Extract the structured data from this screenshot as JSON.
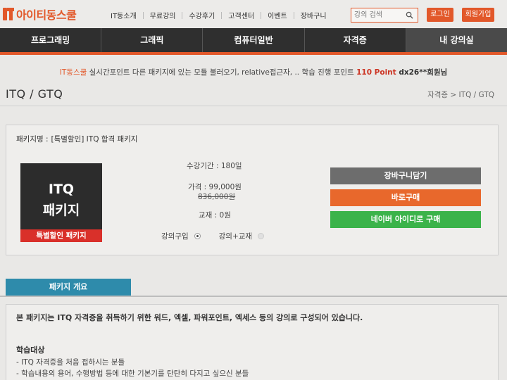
{
  "header": {
    "logo_text": "아이티동스쿨",
    "nav": [
      "IT동소개",
      "무료강의",
      "수강후기",
      "고객센터",
      "이벤트",
      "장바구니"
    ],
    "search_placeholder": "강의 검색",
    "login": "로그인",
    "join": "회원가입"
  },
  "main_nav": [
    "프로그래밍",
    "그래픽",
    "컴퓨터일반",
    "자격증",
    "내 강의실"
  ],
  "notice": {
    "brand": "IT동스쿨",
    "message": " 실시간포인트 다른 패키지에 있는 모듈 불러오기, relative접근자, .. 학습 진행 포인트 ",
    "points": "110 Point",
    "user": " dx26**회원님"
  },
  "page": {
    "title": "ITQ / GTQ",
    "breadcrumb": "자격증 > ITQ / GTQ"
  },
  "package": {
    "name_label": "패키지명 :",
    "name": "[특별할인] ITQ 합격 패키지",
    "thumb_line1": "ITQ",
    "thumb_line2": "패키지",
    "thumb_band": "특별할인 패키지",
    "period": "수강기간 : 180일",
    "price": "가격 : 99,000원",
    "original_price": "836,000원",
    "book": "교재 : 0원",
    "option_course": "강의구입",
    "option_course_book": "강의+교재",
    "cart_button": "장바구니담기",
    "buy_button": "바로구매",
    "naver_button": "네이버 아이디로 구매"
  },
  "overview": {
    "tab": "패키지 개요",
    "intro": "본 패키지는 ITQ 자격증을 취득하기 위한 워드, 엑셀, 파워포인트, 엑세스 등의 강의로 구성되어 있습니다.",
    "target_heading": "학습대상",
    "targets": [
      "- ITQ 자격증을 처음 접하시는 분들",
      "- 학습내용의 용어, 수행방법 등에 대한 기본기를 탄탄히 다지고 싶으신 분들"
    ]
  },
  "colors": {
    "accent": "#e2582a",
    "nav_bg": "#2f2f2f",
    "cart": "#6d6d6d",
    "buy": "#e8682c",
    "naver": "#3bb34a",
    "tab": "#2e8bab"
  }
}
